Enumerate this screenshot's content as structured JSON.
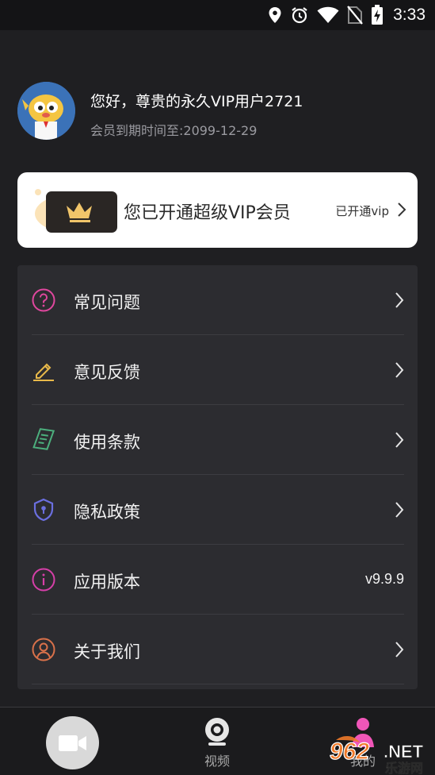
{
  "status_bar": {
    "time": "3:33",
    "icons": [
      "location-icon",
      "alarm-icon",
      "wifi-icon",
      "no-sim-icon",
      "battery-charging-icon"
    ]
  },
  "profile": {
    "greeting": "您好，尊贵的永久VIP用户2721",
    "expire": "会员到期时间至:2099-12-29",
    "avatar_icon": "cartoon-avatar-icon"
  },
  "vip_card": {
    "title": "您已开通超级VIP会员",
    "status": "已开通vip",
    "icon": "crown-card-icon"
  },
  "menu": {
    "items": [
      {
        "label": "常见问题",
        "icon": "question-icon",
        "color": "#e0479e"
      },
      {
        "label": "意见反馈",
        "icon": "pencil-icon",
        "color": "#e8b94a"
      },
      {
        "label": "使用条款",
        "icon": "document-icon",
        "color": "#4caf7d"
      },
      {
        "label": "隐私政策",
        "icon": "shield-lock-icon",
        "color": "#6b6fe0"
      },
      {
        "label": "应用版本",
        "icon": "info-icon",
        "color": "#d63fa8",
        "value": "v9.9.9"
      },
      {
        "label": "关于我们",
        "icon": "person-icon",
        "color": "#d9714a"
      }
    ]
  },
  "tabbar": {
    "record_icon": "video-camera-icon",
    "video_label": "视频",
    "me_label": "我的"
  },
  "watermark": {
    "brand": "962",
    "suffix": ".NET",
    "subtitle": "乐游网"
  }
}
